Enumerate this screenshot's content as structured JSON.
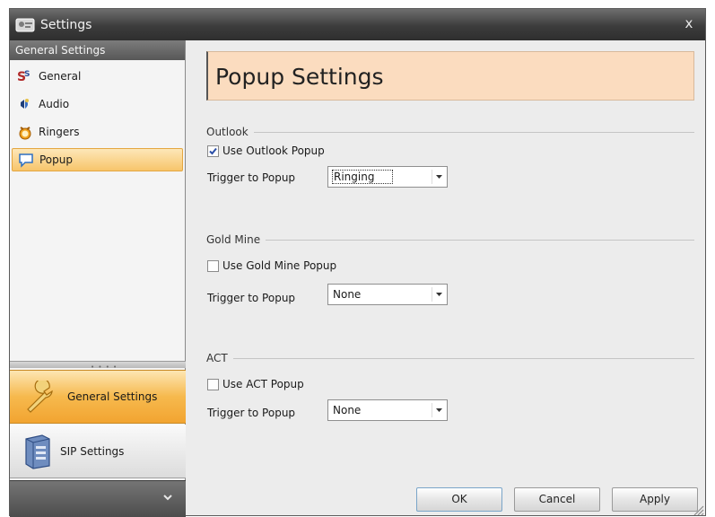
{
  "window": {
    "title": "Settings",
    "close_label": "x"
  },
  "sidebar": {
    "header": "General Settings",
    "items": [
      {
        "label": "General",
        "icon": "general-settings-icon"
      },
      {
        "label": "Audio",
        "icon": "audio-icon"
      },
      {
        "label": "Ringers",
        "icon": "ringers-icon"
      },
      {
        "label": "Popup",
        "icon": "popup-speech-bubble-icon",
        "selected": true
      }
    ],
    "nav_buttons": [
      {
        "label": "General Settings",
        "icon": "wrench-icon",
        "selected": true
      },
      {
        "label": "SIP Settings",
        "icon": "sip-server-icon"
      }
    ]
  },
  "content": {
    "page_title": "Popup Settings",
    "sections": [
      {
        "title": "Outlook",
        "checkbox_label": "Use Outlook Popup",
        "checked": true,
        "trigger_label": "Trigger to Popup",
        "trigger_value": "Ringing"
      },
      {
        "title": "Gold Mine",
        "checkbox_label": "Use Gold Mine Popup",
        "checked": false,
        "trigger_label": "Trigger to Popup",
        "trigger_value": "None"
      },
      {
        "title": "ACT",
        "checkbox_label": "Use ACT Popup",
        "checked": false,
        "trigger_label": "Trigger to Popup",
        "trigger_value": "None"
      }
    ]
  },
  "buttons": {
    "ok": "OK",
    "cancel": "Cancel",
    "apply": "Apply"
  },
  "colors": {
    "accent": "#f6b94d",
    "title_box": "#fbdcbf",
    "titlebar": "#3c3c3c"
  }
}
